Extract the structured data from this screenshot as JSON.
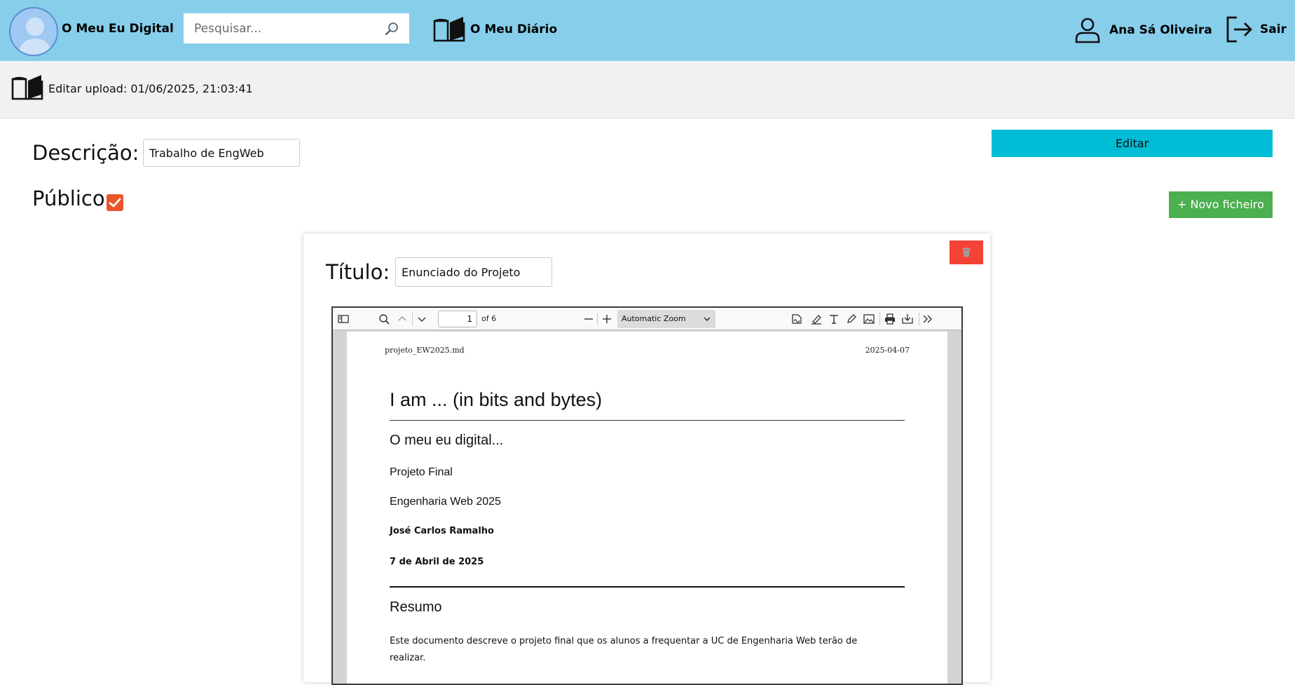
{
  "header": {
    "brand": "O Meu Eu Digital",
    "search_placeholder": "Pesquisar...",
    "diary_label": "O Meu Diário",
    "user_name": "Ana Sá Oliveira",
    "logout_label": "Sair"
  },
  "subheader": {
    "title": "Editar upload: 01/06/2025, 21:03:41"
  },
  "form": {
    "description_label": "Descrição:",
    "description_value": "Trabalho de EngWeb",
    "public_label": "Público",
    "public_checked": true,
    "edit_button": "Editar",
    "new_file_button": "+ Novo ficheiro"
  },
  "file_card": {
    "title_label": "Título:",
    "title_value": "Enunciado do Projeto",
    "pdf_toolbar": {
      "page_number": "1",
      "page_of": "of 6",
      "zoom": "Automatic Zoom"
    },
    "pdf_page": {
      "filename": "projeto_EW2025.md",
      "date": "2025-04-07",
      "heading": "I am ... (in bits and bytes)",
      "subheading": "O meu eu digital...",
      "line1": "Projeto Final",
      "line2": "Engenharia Web 2025",
      "author": "José Carlos Ramalho",
      "author_date": "7 de Abril de 2025",
      "section_title": "Resumo",
      "body": "Este documento descreve o projeto final que os alunos a frequentar a UC de Engenharia Web terão de realizar."
    }
  },
  "colors": {
    "topbar": "#87ceeb",
    "edit_button": "#00bcd4",
    "new_button": "#4caf50",
    "delete_button": "#f44336",
    "checkbox": "#e8562a"
  }
}
